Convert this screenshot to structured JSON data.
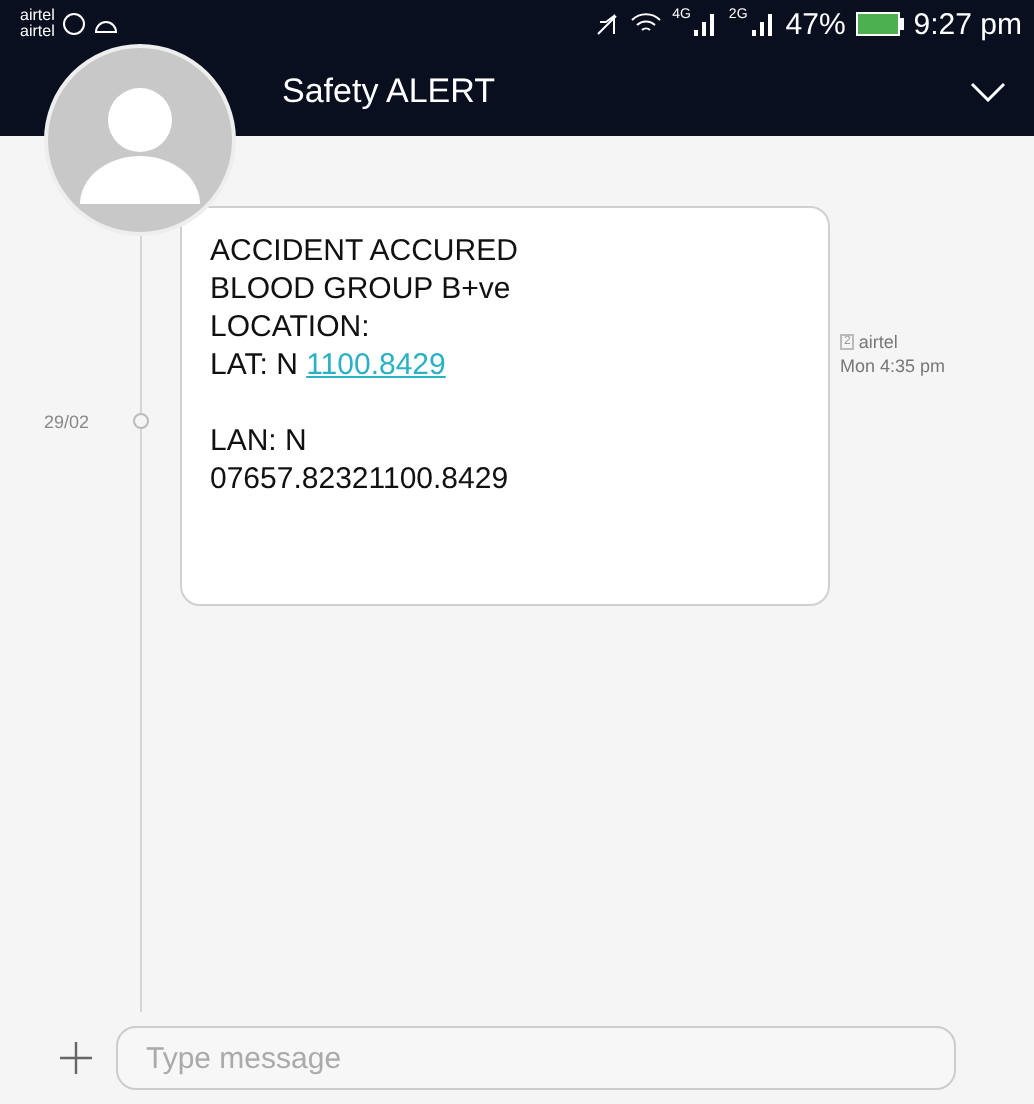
{
  "status_bar": {
    "carriers": [
      "airtel",
      "airtel"
    ],
    "network_labels": [
      "4G",
      "2G"
    ],
    "battery": "47%",
    "time": "9:27 pm"
  },
  "header": {
    "title": "Safety ALERT"
  },
  "thread": {
    "date": "29/02",
    "message": {
      "paragraphs": [
        {
          "lines": [
            {
              "text": "ACCIDENT ACCURED"
            },
            {
              "text": "BLOOD GROUP B+ve"
            },
            {
              "text": "LOCATION:"
            },
            {
              "text": "LAT: N ",
              "link": "1100.8429"
            }
          ]
        },
        {
          "lines": [
            {
              "text": "LAN: N"
            },
            {
              "text": "07657.82321100.8429"
            }
          ]
        }
      ],
      "sim": "2",
      "sender": "airtel",
      "time": "Mon 4:35 pm"
    }
  },
  "composer": {
    "placeholder": "Type message"
  }
}
